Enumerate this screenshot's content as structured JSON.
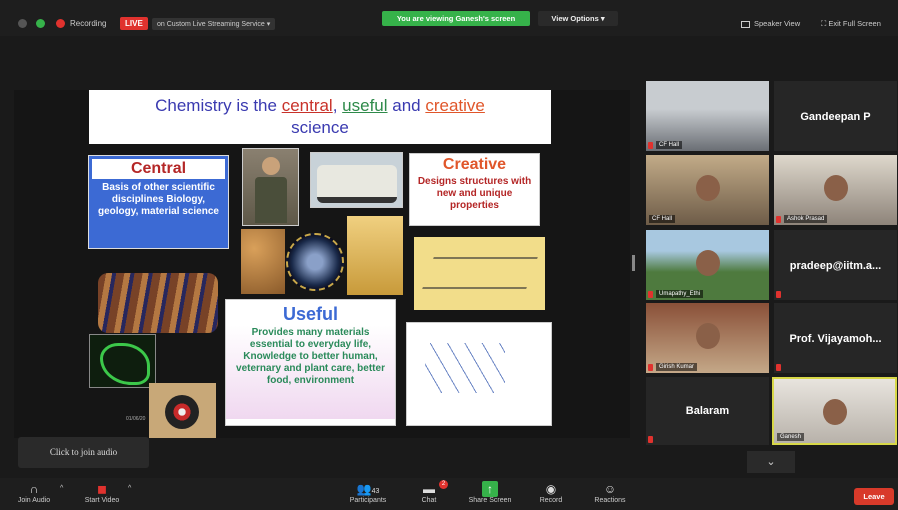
{
  "topbar": {
    "recording_label": "Recording",
    "live_label": "LIVE",
    "stream_service": "on Custom Live Streaming Service",
    "viewing_banner": "You are viewing Ganesh's screen",
    "view_options": "View Options",
    "speaker_view": "Speaker View",
    "exit_full_screen": "Exit Full Screen"
  },
  "slide": {
    "title_part1": "Chemistry is the ",
    "title_central": "central",
    "title_sep": ", ",
    "title_useful": "useful",
    "title_and": " and ",
    "title_creative": "creative",
    "title_line2": "science",
    "central_heading": "Central",
    "central_body": "Basis of other scientific disciplines Biology, geology, material science",
    "creative_heading": "Creative",
    "creative_body": "Designs structures with new and unique properties",
    "useful_heading": "Useful",
    "useful_body": "Provides many materials essential to everyday life, Knowledge to better human, veternary and plant care, better food, environment",
    "date_label": "01/06/20"
  },
  "gallery": {
    "tiles": [
      {
        "name": "",
        "label": "CF Hall"
      },
      {
        "name": "Gandeepan P",
        "label": ""
      },
      {
        "name": "",
        "label": "CF Hall"
      },
      {
        "name": "",
        "label": "Ashok Prasad"
      },
      {
        "name": "",
        "label": "Umapathy_Ethi"
      },
      {
        "name": "pradeep@iitm.a...",
        "label": ""
      },
      {
        "name": "",
        "label": "Girish Kumar"
      },
      {
        "name": "Prof. Vijayamoh...",
        "label": ""
      },
      {
        "name": "Balaram",
        "label": ""
      },
      {
        "name": "",
        "label": "Ganesh"
      }
    ]
  },
  "audio_tooltip": "Click to join audio",
  "toolbar": {
    "join_audio": "Join Audio",
    "start_video": "Start Video",
    "participants": "Participants",
    "participants_count": "43",
    "chat": "Chat",
    "chat_badge": "2",
    "share_screen": "Share Screen",
    "record": "Record",
    "reactions": "Reactions",
    "leave": "Leave"
  }
}
